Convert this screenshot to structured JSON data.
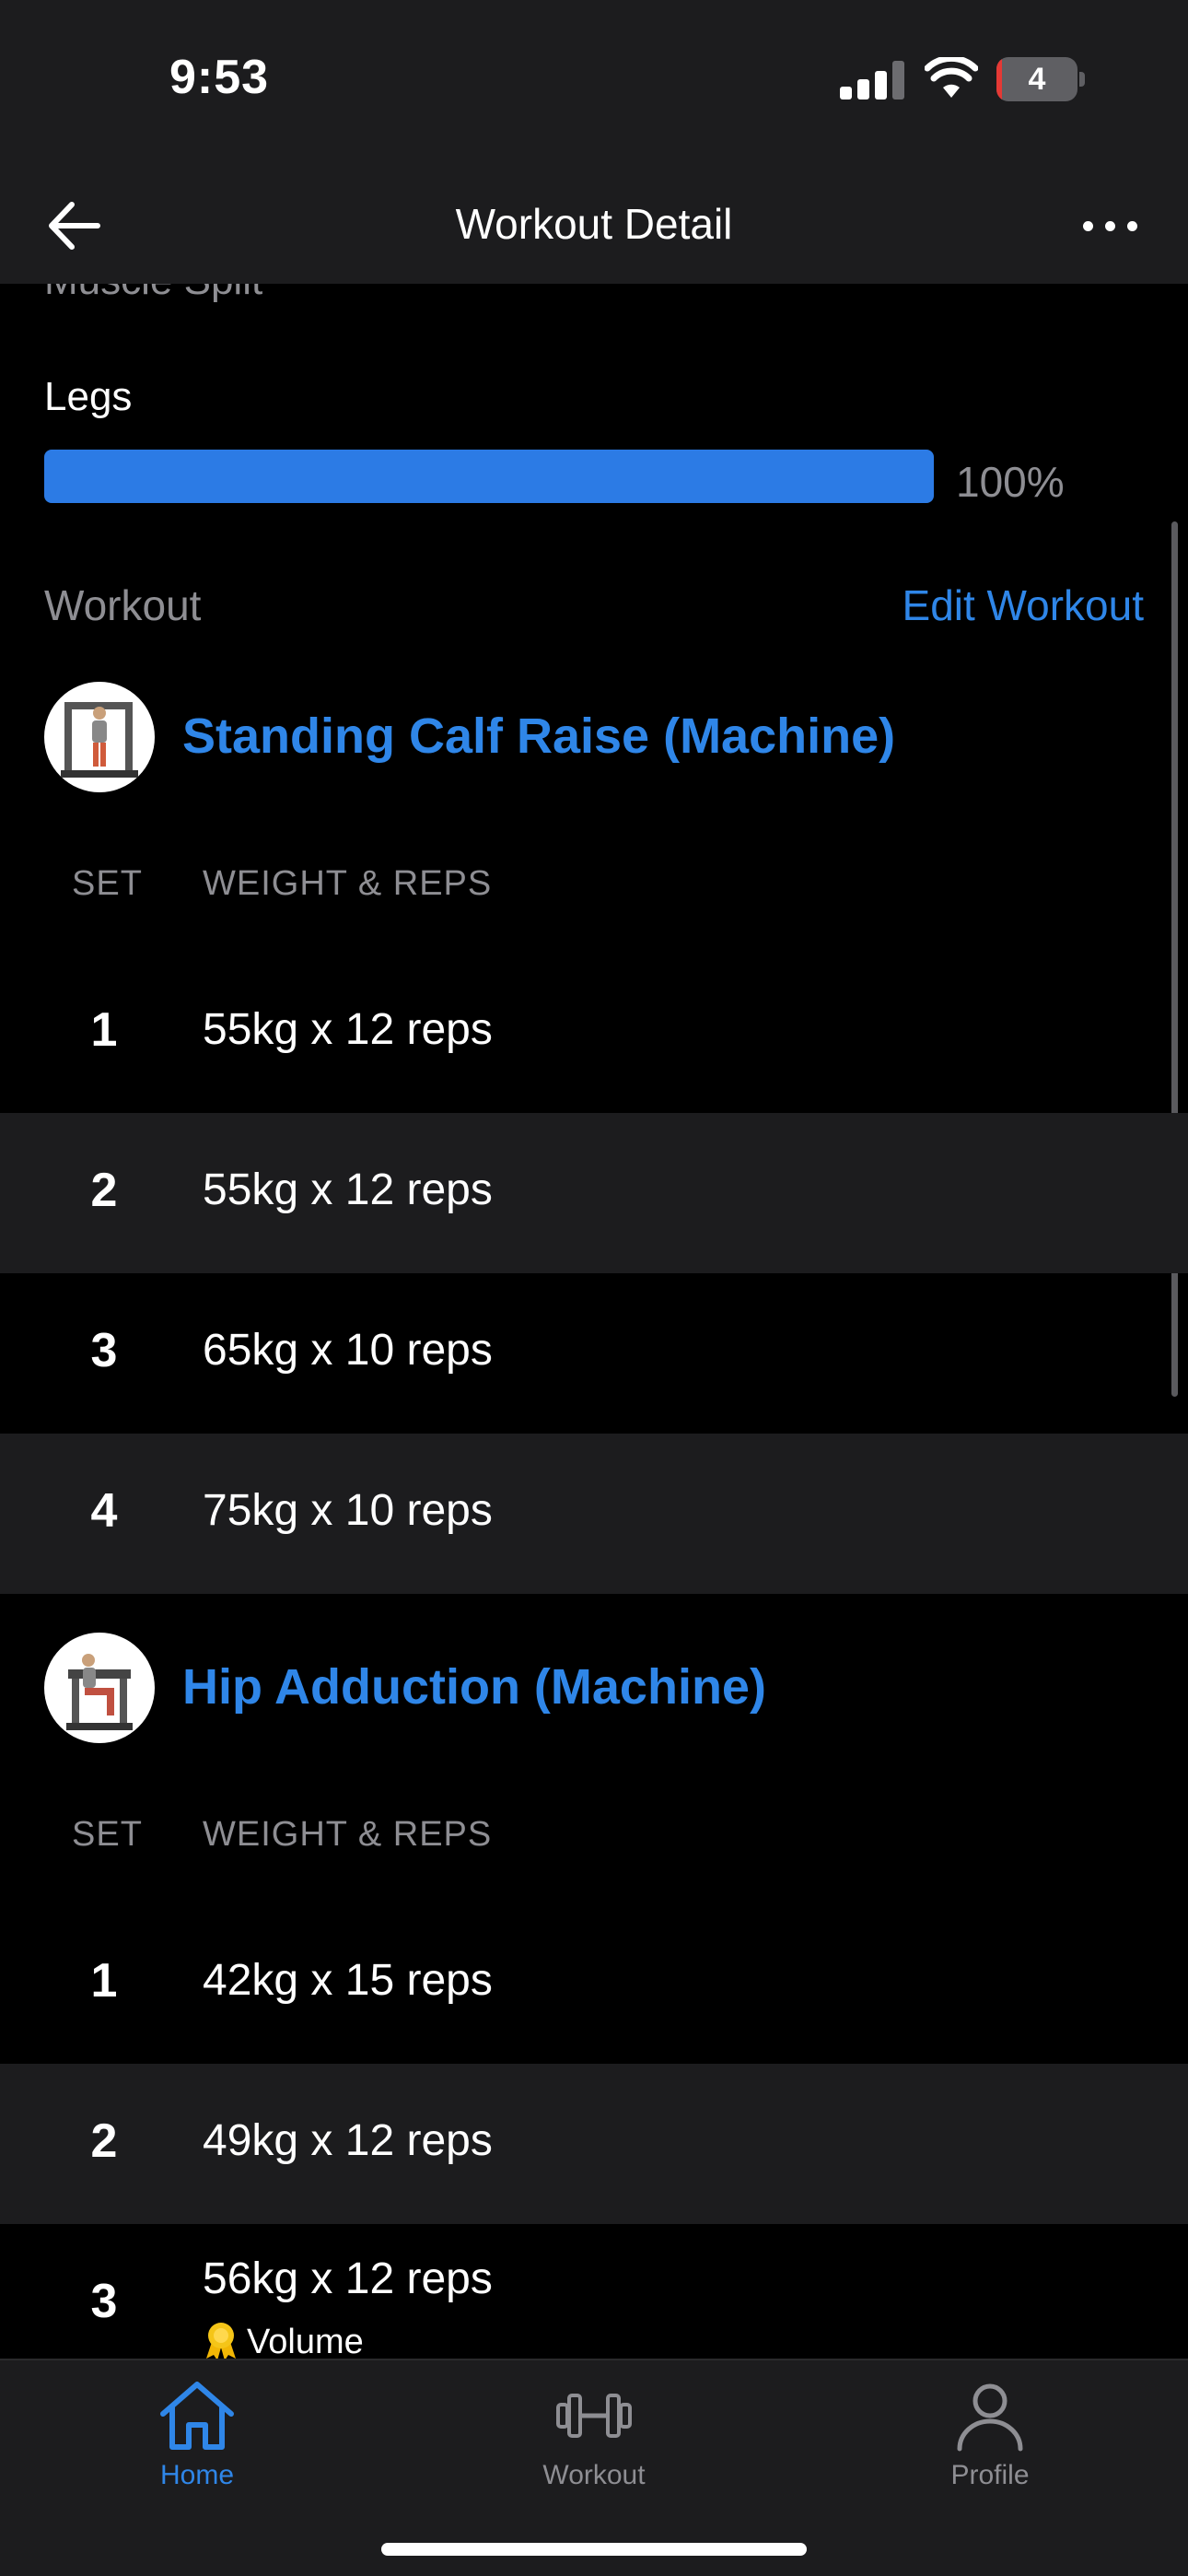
{
  "status_bar": {
    "time": "9:53",
    "battery_level": "4",
    "icons": [
      "signal-icon",
      "wifi-icon",
      "battery-icon"
    ]
  },
  "nav": {
    "title": "Workout Detail",
    "back_icon": "arrow-left-icon",
    "more_icon": "ellipsis-icon"
  },
  "muscle_split": {
    "label": "Muscle Split",
    "items": [
      {
        "name": "Legs",
        "percent_text": "100%",
        "percent": 100
      }
    ]
  },
  "workout": {
    "label": "Workout",
    "edit_label": "Edit Workout",
    "set_header": "SET",
    "weight_header": "WEIGHT & REPS",
    "exercises": [
      {
        "name": "Standing Calf Raise (Machine)",
        "sets": [
          {
            "set": "1",
            "value": "55kg x 12 reps"
          },
          {
            "set": "2",
            "value": "55kg x 12 reps"
          },
          {
            "set": "3",
            "value": "65kg x 10 reps"
          },
          {
            "set": "4",
            "value": "75kg x 10 reps"
          }
        ]
      },
      {
        "name": "Hip Adduction (Machine)",
        "sets": [
          {
            "set": "1",
            "value": "42kg x 15 reps"
          },
          {
            "set": "2",
            "value": "49kg x 12 reps"
          },
          {
            "set": "3",
            "value": "56kg x 12 reps",
            "tag": "Volume"
          }
        ]
      }
    ]
  },
  "tab_bar": {
    "tabs": [
      {
        "label": "Home",
        "icon": "home-icon",
        "active": true
      },
      {
        "label": "Workout",
        "icon": "dumbbell-icon",
        "active": false
      },
      {
        "label": "Profile",
        "icon": "profile-icon",
        "active": false
      }
    ]
  },
  "colors": {
    "accent": "#2f86e8",
    "progress": "#2c7be5",
    "background": "#000000",
    "surface": "#1c1c1e",
    "muted": "#8e8e93"
  }
}
